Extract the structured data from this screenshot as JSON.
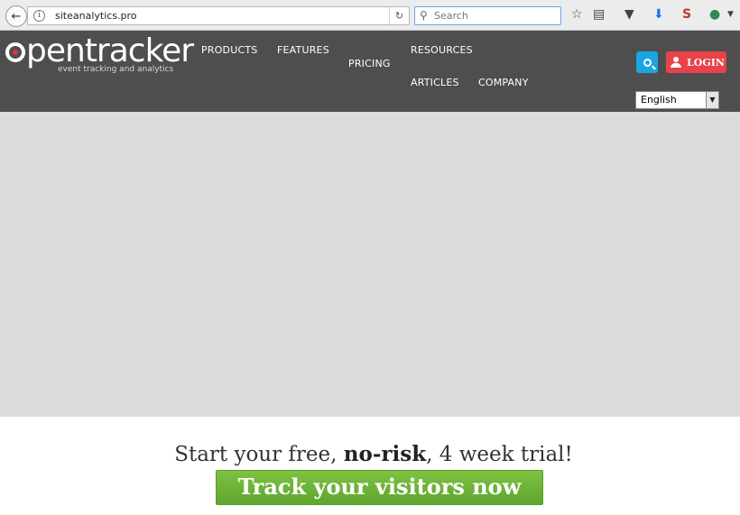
{
  "browser": {
    "url": "siteanalytics.pro",
    "search_placeholder": "Search"
  },
  "header": {
    "logo_text": "pentracker",
    "logo_tagline": "event tracking and analytics",
    "nav": {
      "products": "PRODUCTS",
      "features": "FEATURES",
      "pricing": "PRICING",
      "resources": "RESOURCES",
      "articles": "ARTICLES",
      "company": "COMPANY"
    },
    "login_label": "LOGIN",
    "language_selected": "English"
  },
  "cta": {
    "trial_pre": "Start your free, ",
    "trial_bold": "no-risk",
    "trial_post": ", 4 week trial!",
    "button_label": "Track your visitors now"
  },
  "colors": {
    "header_bg": "#4e4e4e",
    "search_button": "#1aa6e0",
    "login_button": "#e8424a",
    "cta_green": "#6cb33a",
    "hero_placeholder": "#dcdcdc"
  }
}
